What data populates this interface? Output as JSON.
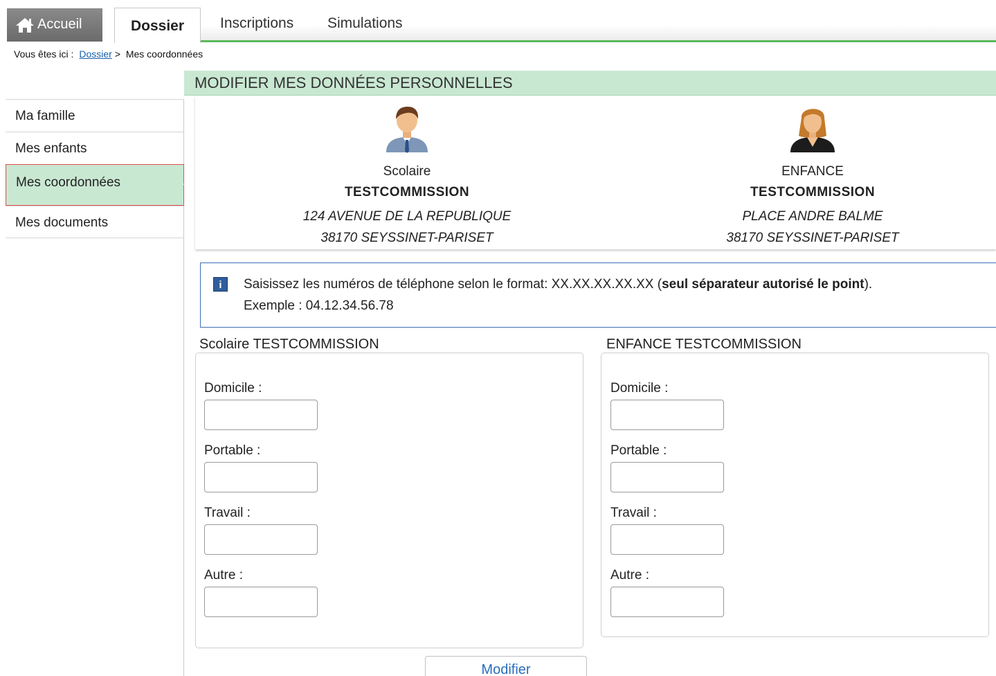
{
  "tabs": {
    "home": "Accueil",
    "dossier": "Dossier",
    "inscriptions": "Inscriptions",
    "simulations": "Simulations"
  },
  "breadcrumb": {
    "prefix": "Vous êtes ici :",
    "link": "Dossier",
    "sep": ">",
    "current": "Mes coordonnées"
  },
  "sidebar": {
    "items": [
      {
        "label": "Ma famille"
      },
      {
        "label": "Mes enfants"
      },
      {
        "label": "Mes coordonnées",
        "active": true
      },
      {
        "label": "Mes documents"
      }
    ]
  },
  "section": {
    "title": "MODIFIER MES DONNÉES PERSONNELLES"
  },
  "persons": [
    {
      "role": "Scolaire",
      "name": "TESTCOMMISSION",
      "address1": "124 AVENUE DE LA REPUBLIQUE",
      "address2": "38170 SEYSSINET-PARISET",
      "avatar": "man-icon"
    },
    {
      "role": "ENFANCE",
      "name": "TESTCOMMISSION",
      "address1": "PLACE ANDRE BALME",
      "address2": "38170 SEYSSINET-PARISET",
      "avatar": "woman-icon"
    }
  ],
  "info": {
    "line1_text": "Saisissez les numéros de téléphone selon le format: XX.XX.XX.XX.XX (",
    "line1_bold": "seul séparateur autorisé le point",
    "line1_end": ").",
    "line2": "Exemple : 04.12.34.56.78"
  },
  "forms": [
    {
      "legend": "Scolaire TESTCOMMISSION",
      "fields": [
        {
          "label": "Domicile :",
          "value": ""
        },
        {
          "label": "Portable :",
          "value": ""
        },
        {
          "label": "Travail :",
          "value": ""
        },
        {
          "label": "Autre :",
          "value": ""
        }
      ]
    },
    {
      "legend": "ENFANCE TESTCOMMISSION",
      "fields": [
        {
          "label": "Domicile :",
          "value": ""
        },
        {
          "label": "Portable :",
          "value": ""
        },
        {
          "label": "Travail :",
          "value": ""
        },
        {
          "label": "Autre :",
          "value": ""
        }
      ]
    }
  ],
  "submit": {
    "label": "Modifier"
  },
  "colors": {
    "accent_green": "#5cb85c",
    "header_band": "#c9e8d2",
    "link_blue": "#1a5fa8",
    "info_border": "#3d6fb6"
  }
}
